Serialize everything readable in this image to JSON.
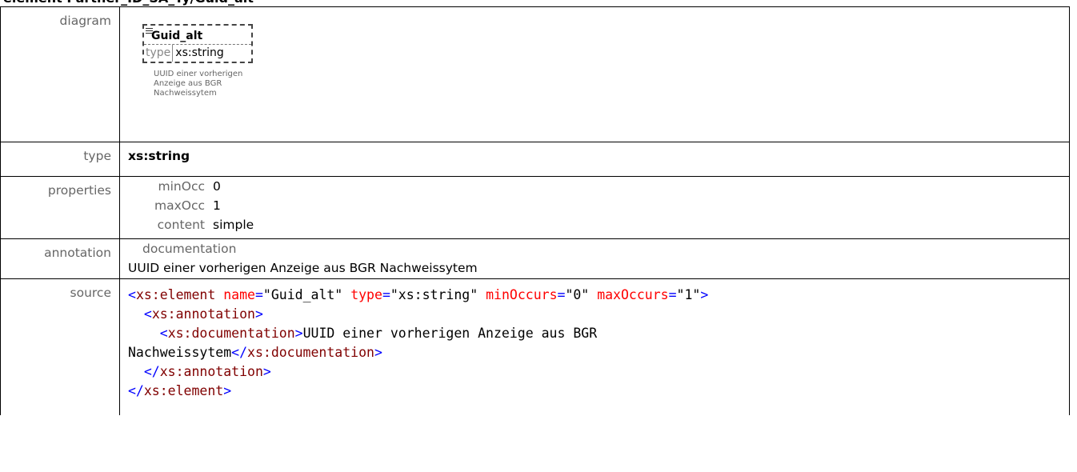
{
  "heading": "element Partner_ID_SA_Ty/Guid_alt",
  "rows": {
    "diagram": {
      "label": "diagram",
      "element_name": "Guid_alt",
      "type_key": "type",
      "type_value": "xs:string",
      "doc_lines": [
        "UUID einer vorherigen",
        "Anzeige aus BGR",
        "Nachweissytem"
      ]
    },
    "type": {
      "label": "type",
      "value": "xs:string"
    },
    "properties": {
      "label": "properties",
      "items": [
        {
          "key": "minOcc",
          "value": "0"
        },
        {
          "key": "maxOcc",
          "value": "1"
        },
        {
          "key": "content",
          "value": "simple"
        }
      ]
    },
    "annotation": {
      "label": "annotation",
      "heading": "documentation",
      "text": "UUID einer vorherigen Anzeige aus BGR Nachweissytem"
    },
    "source": {
      "label": "source",
      "line1": {
        "tag": "xs:element",
        "a1": "name",
        "v1": "\"Guid_alt\"",
        "a2": "type",
        "v2": "\"xs:string\"",
        "a3": "minOccurs",
        "v3": "\"0\"",
        "a4": "maxOccurs",
        "v4": "\"1\""
      },
      "line2": {
        "tag": "xs:annotation"
      },
      "line3": {
        "tag": "xs:documentation",
        "text": "UUID einer vorherigen Anzeige aus BGR"
      },
      "line4": {
        "text": "Nachweissytem",
        "close": "xs:documentation"
      },
      "line5": {
        "close": "xs:annotation"
      },
      "line6": {
        "close": "xs:element"
      }
    }
  }
}
